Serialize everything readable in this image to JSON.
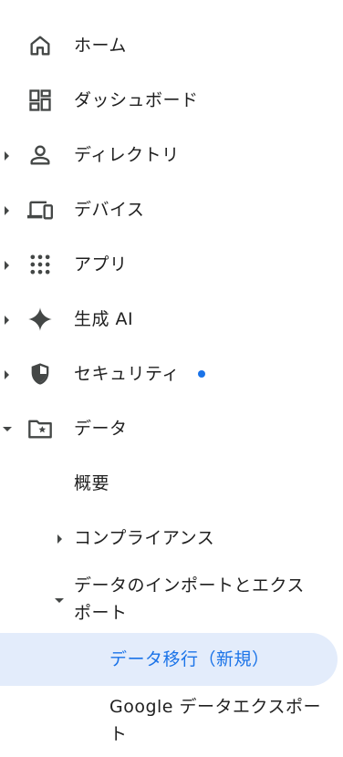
{
  "nav": {
    "items": [
      {
        "label": "ホーム",
        "icon": "home-icon"
      },
      {
        "label": "ダッシュボード",
        "icon": "dashboard-icon"
      },
      {
        "label": "ディレクトリ",
        "icon": "person-icon"
      },
      {
        "label": "デバイス",
        "icon": "devices-icon"
      },
      {
        "label": "アプリ",
        "icon": "apps-grid-icon"
      },
      {
        "label": "生成 AI",
        "icon": "sparkle-icon"
      },
      {
        "label": "セキュリティ",
        "icon": "shield-icon"
      },
      {
        "label": "データ",
        "icon": "folder-star-icon"
      }
    ],
    "data_children": {
      "overview": "概要",
      "compliance": "コンプライアンス",
      "import_export_line1": "データのインポートとエクス",
      "import_export_line2": "ポート",
      "migration_selected": "データ移行（新規）",
      "google_export_line1": "Google データエクスポー",
      "google_export_line2": "ト"
    },
    "colors": {
      "selected_text": "#1a73e8",
      "selected_bg": "#e3ecfb",
      "notification_dot": "#1a73e8",
      "icon": "#444746"
    }
  }
}
